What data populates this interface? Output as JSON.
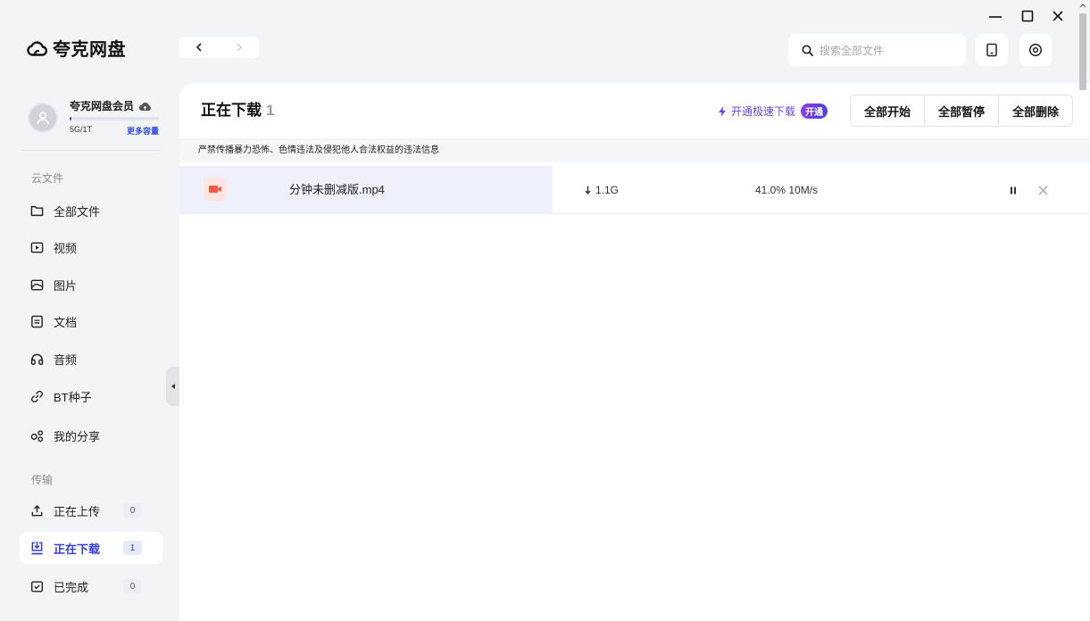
{
  "app": {
    "name": "夸克网盘",
    "logo_icon": "cloud-logo-icon"
  },
  "search": {
    "placeholder": "搜索全部文件",
    "icon": "search-icon"
  },
  "toolbar_icons": [
    "phone-icon",
    "settings-icon"
  ],
  "user": {
    "name": "夸克网盘会员",
    "storage_text": "5G/1T",
    "more_storage": "更多容量",
    "storage_used_fraction": 0.005
  },
  "sidebar": {
    "cloud_section": "云文件",
    "cloud_items": [
      {
        "label": "全部文件",
        "icon": "folder-icon"
      },
      {
        "label": "视频",
        "icon": "video-icon"
      },
      {
        "label": "图片",
        "icon": "image-icon"
      },
      {
        "label": "文档",
        "icon": "document-icon"
      },
      {
        "label": "音频",
        "icon": "headphones-icon"
      },
      {
        "label": "BT种子",
        "icon": "link-icon"
      },
      {
        "label": "我的分享",
        "icon": "share-icon"
      }
    ],
    "transfer_section": "传输",
    "transfer_items": [
      {
        "label": "正在上传",
        "count": "0",
        "icon": "upload-icon",
        "active": false
      },
      {
        "label": "正在下载",
        "count": "1",
        "icon": "download-icon",
        "active": true
      },
      {
        "label": "已完成",
        "count": "0",
        "icon": "completed-icon",
        "active": false
      }
    ]
  },
  "main": {
    "title": "正在下载",
    "count": "1",
    "speedup": {
      "label": "开通极速下载",
      "badge": "开通",
      "icon": "lightning-icon"
    },
    "buttons": [
      "全部开始",
      "全部暂停",
      "全部删除"
    ],
    "notice": "严禁传播暴力恐怖、色情违法及侵犯他人合法权益的违法信息",
    "downloads": [
      {
        "name": "分钟未删减版.mp4",
        "size": "1.1G",
        "progress_text": "41.0%",
        "speed": "10M/s",
        "progress": 0.41,
        "icon": "video-file-icon"
      }
    ]
  },
  "colors": {
    "background": "#f3f4f6",
    "accent": "#3640d6",
    "speedup": "#6a45e6",
    "progress_fill": "#eef0fb",
    "video_icon": "#f25a47"
  }
}
